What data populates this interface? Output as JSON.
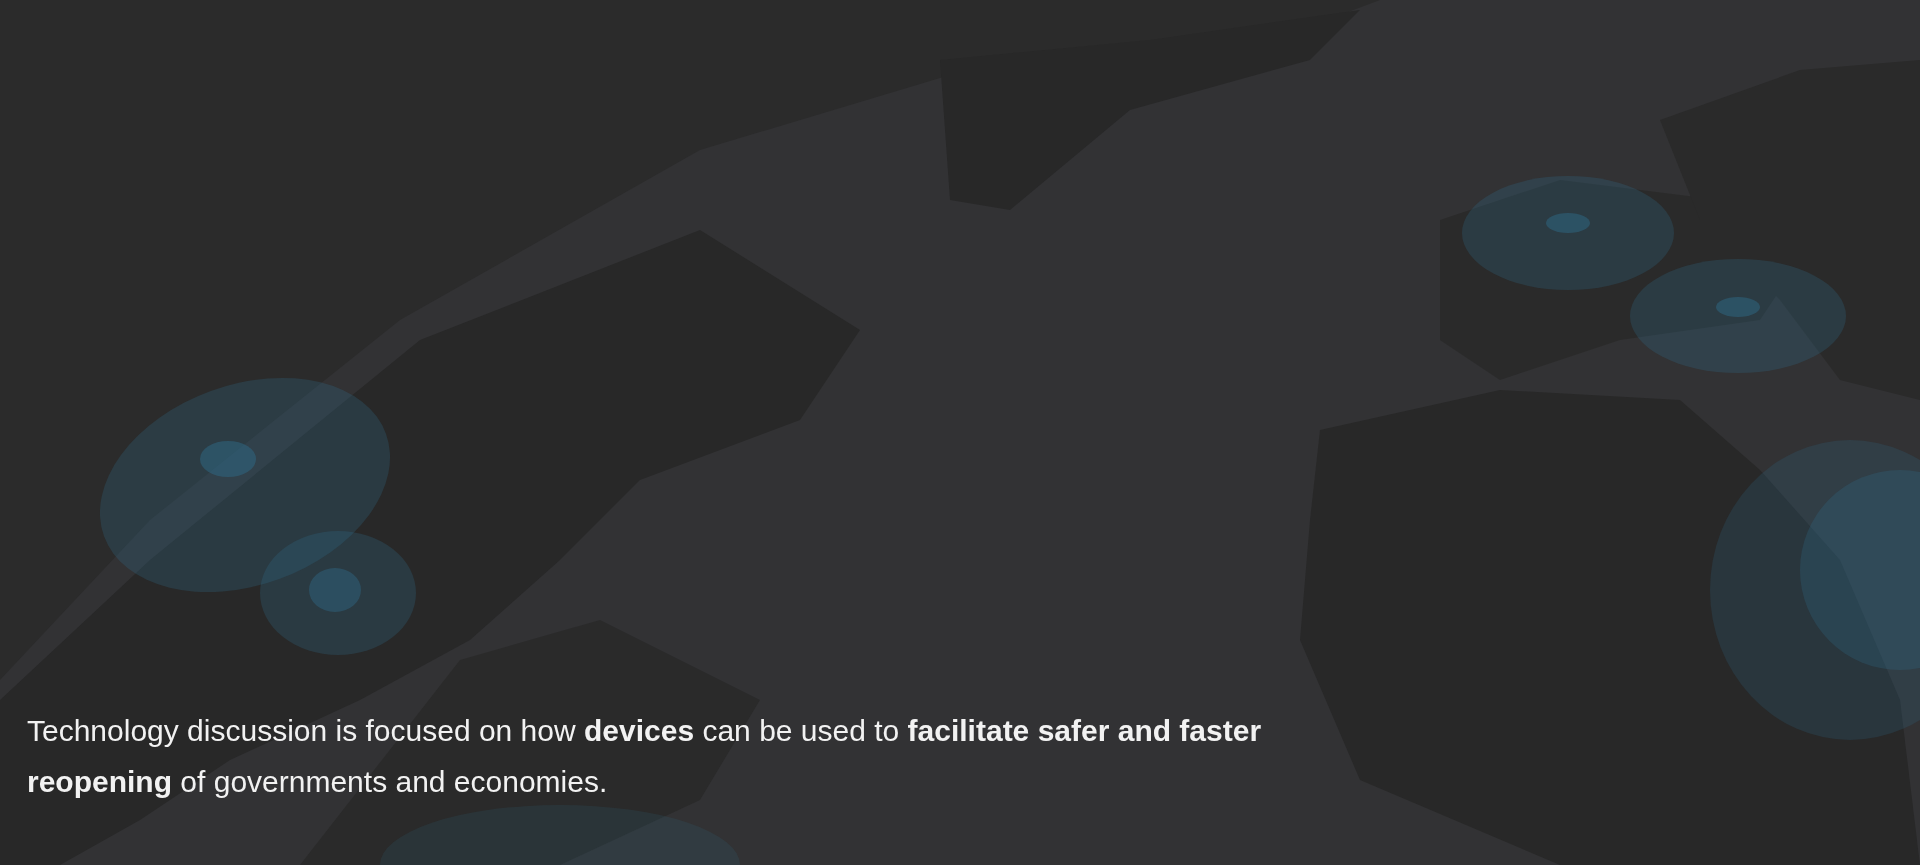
{
  "caption": "Technology discussion is focused on how **devices** can be used to **facilitate safer and faster reopening** of governments and economies."
}
